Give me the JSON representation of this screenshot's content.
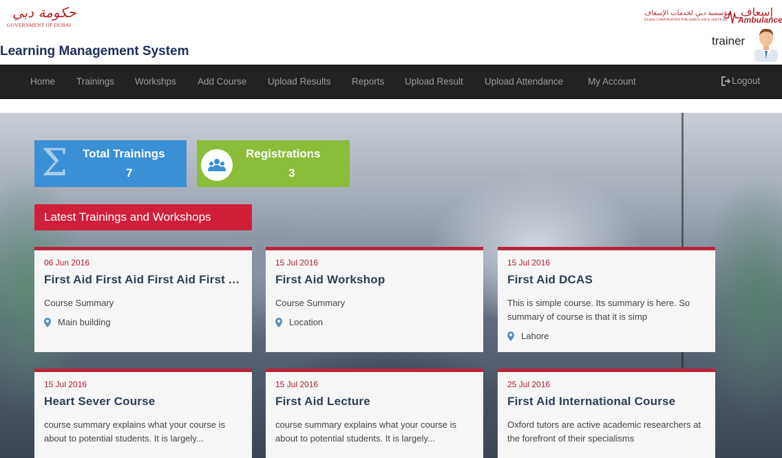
{
  "header": {
    "gov_logo_arabic": "حكومة دبي",
    "gov_logo_english": "GOVERNMENT OF DUBAI",
    "app_title": "Learning Management System",
    "ambulance_logo_arabic_small": "مؤسسة دبي لخدمات الإسعاف",
    "ambulance_logo_english_small": "DUBAI CORPORATION FOR AMBULANCE SERVICES",
    "ambulance_logo_arabic": "إسعاف",
    "ambulance_logo_english": "Ambulance",
    "user_name": "trainer"
  },
  "nav": {
    "items": [
      "Home",
      "Trainings",
      "Workshps",
      "Add Course",
      "Upload Results",
      "Reports",
      "Upload Result",
      "Upload Attendance",
      "My Account"
    ],
    "logout_label": "Logout"
  },
  "stats": {
    "total_trainings": {
      "label": "Total Trainings",
      "value": "7"
    },
    "registrations": {
      "label": "Registrations",
      "value": "3"
    }
  },
  "section": {
    "heading": "Latest Trainings and Workshops"
  },
  "courses": [
    {
      "date": "06 Jun 2016",
      "title": "First Aid First Aid First Aid First Aid",
      "summary": "Course Summary",
      "location": "Main building"
    },
    {
      "date": "15 Jul 2016",
      "title": "First Aid Workshop",
      "summary": "Course Summary",
      "location": "Location"
    },
    {
      "date": "15 Jul 2016",
      "title": "First Aid DCAS",
      "summary": "This is simple course. Its summary is here. So summary of course is that it is simp",
      "location": "Lahore"
    },
    {
      "date": "15 Jul 2016",
      "title": "Heart Sever Course",
      "summary": "course summary explains what your course is about to potential students. It is largely...",
      "location": ""
    },
    {
      "date": "15 Jul 2016",
      "title": "First Aid Lecture",
      "summary": "course summary explains what your course is about to potential students. It is largely...",
      "location": ""
    },
    {
      "date": "25 Jul 2016",
      "title": "First Aid International Course",
      "summary": "Oxford tutors are active academic researchers at the forefront of their specialisms",
      "location": ""
    }
  ],
  "colors": {
    "navbar_bg": "#222222",
    "stat_blue": "#3a8fd5",
    "stat_green": "#8bbd3a",
    "section_red": "#d01f3a",
    "card_border": "#b8243a",
    "title_navy": "#1c2e5a"
  },
  "icons": {
    "stat_total": "sigma-icon",
    "stat_registrations": "users-icon",
    "location": "map-marker-icon",
    "logout": "sign-out-icon"
  }
}
